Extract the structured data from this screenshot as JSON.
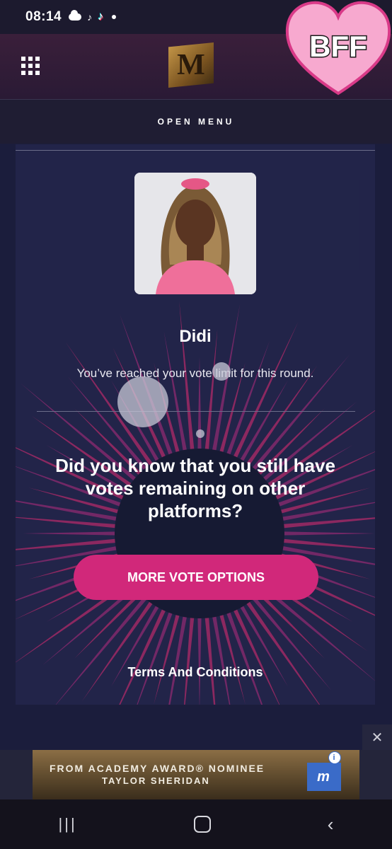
{
  "status_bar": {
    "time": "08:14",
    "icons": [
      "cloud-icon",
      "tiktok-icon",
      "tiktok-color-icon",
      "dot-icon"
    ]
  },
  "header": {
    "menu_icon": "grid-icon",
    "logo": "m-logo",
    "badge_text": "BFF"
  },
  "menu_bar": {
    "label": "OPEN MENU"
  },
  "card": {
    "name": "Didi",
    "limit_message": "You’ve reached your vote limit for this round.",
    "headline": "Did you know that you still have votes remaining on other platforms?",
    "button_label": "MORE VOTE OPTIONS",
    "terms_label": "Terms And Conditions"
  },
  "ad": {
    "line1": "FROM ACADEMY AWARD® NOMINEE",
    "line2": "TAYLOR SHERIDAN",
    "close": "✕",
    "info": "i"
  },
  "nav_bar": {
    "recent": "|||",
    "back": "‹"
  },
  "colors": {
    "accent": "#d1287a",
    "background": "#1b1d3c",
    "badge_pink": "#f7a9cf"
  }
}
